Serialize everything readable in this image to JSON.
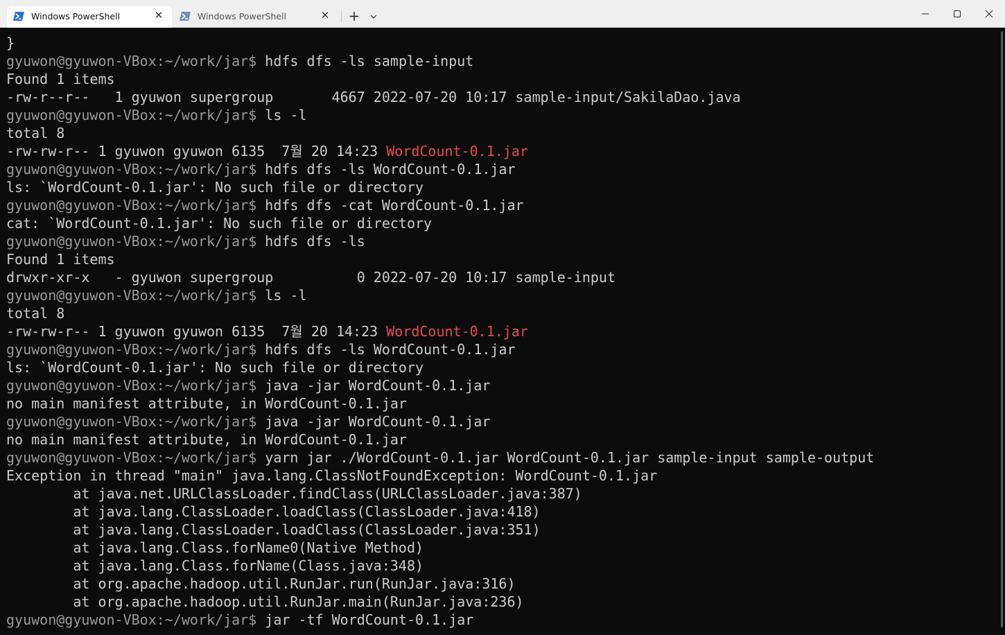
{
  "titlebar": {
    "tabs": [
      {
        "label": "Windows PowerShell",
        "active": true,
        "icon": "powershell-icon"
      },
      {
        "label": "Windows PowerShell",
        "active": false,
        "icon": "powershell-icon"
      }
    ],
    "close_glyph": "✕",
    "new_tab_glyph": "+",
    "dropdown_glyph": "⌄",
    "window_controls": {
      "minimize": "—",
      "maximize": "☐",
      "close": "✕"
    }
  },
  "colors": {
    "background": "#0c0c0c",
    "text": "#cccccc",
    "prompt": "#9a9a9a",
    "jar_highlight": "#e74856"
  },
  "terminal": {
    "lines": [
      {
        "kind": "output",
        "text": "}"
      },
      {
        "kind": "prompt",
        "user": "gyuwon@gyuwon-VBox",
        "path": ":~/work/jar$",
        "cmd": " hdfs dfs -ls sample-input"
      },
      {
        "kind": "output",
        "text": "Found 1 items"
      },
      {
        "kind": "output",
        "text": "-rw-r--r--   1 gyuwon supergroup       4667 2022-07-20 10:17 sample-input/SakilaDao.java"
      },
      {
        "kind": "prompt",
        "user": "gyuwon@gyuwon-VBox",
        "path": ":~/work/jar$",
        "cmd": " ls -l"
      },
      {
        "kind": "output",
        "text": "total 8"
      },
      {
        "kind": "highlight",
        "text": "-rw-rw-r-- 1 gyuwon gyuwon 6135  7월 20 14:23 ",
        "red": "WordCount-0.1.jar"
      },
      {
        "kind": "prompt",
        "user": "gyuwon@gyuwon-VBox",
        "path": ":~/work/jar$",
        "cmd": " hdfs dfs -ls WordCount-0.1.jar"
      },
      {
        "kind": "output",
        "text": "ls: `WordCount-0.1.jar': No such file or directory"
      },
      {
        "kind": "prompt",
        "user": "gyuwon@gyuwon-VBox",
        "path": ":~/work/jar$",
        "cmd": " hdfs dfs -cat WordCount-0.1.jar"
      },
      {
        "kind": "output",
        "text": "cat: `WordCount-0.1.jar': No such file or directory"
      },
      {
        "kind": "prompt",
        "user": "gyuwon@gyuwon-VBox",
        "path": ":~/work/jar$",
        "cmd": " hdfs dfs -ls"
      },
      {
        "kind": "output",
        "text": "Found 1 items"
      },
      {
        "kind": "output",
        "text": "drwxr-xr-x   - gyuwon supergroup          0 2022-07-20 10:17 sample-input"
      },
      {
        "kind": "prompt",
        "user": "gyuwon@gyuwon-VBox",
        "path": ":~/work/jar$",
        "cmd": " ls -l"
      },
      {
        "kind": "output",
        "text": "total 8"
      },
      {
        "kind": "highlight",
        "text": "-rw-rw-r-- 1 gyuwon gyuwon 6135  7월 20 14:23 ",
        "red": "WordCount-0.1.jar"
      },
      {
        "kind": "prompt",
        "user": "gyuwon@gyuwon-VBox",
        "path": ":~/work/jar$",
        "cmd": " hdfs dfs -ls WordCount-0.1.jar"
      },
      {
        "kind": "output",
        "text": "ls: `WordCount-0.1.jar': No such file or directory"
      },
      {
        "kind": "prompt",
        "user": "gyuwon@gyuwon-VBox",
        "path": ":~/work/jar$",
        "cmd": " java -jar WordCount-0.1.jar"
      },
      {
        "kind": "output",
        "text": "no main manifest attribute, in WordCount-0.1.jar"
      },
      {
        "kind": "prompt",
        "user": "gyuwon@gyuwon-VBox",
        "path": ":~/work/jar$",
        "cmd": " java -jar WordCount-0.1.jar"
      },
      {
        "kind": "output",
        "text": "no main manifest attribute, in WordCount-0.1.jar"
      },
      {
        "kind": "prompt",
        "user": "gyuwon@gyuwon-VBox",
        "path": ":~/work/jar$",
        "cmd": " yarn jar ./WordCount-0.1.jar WordCount-0.1.jar sample-input sample-output"
      },
      {
        "kind": "output",
        "text": "Exception in thread \"main\" java.lang.ClassNotFoundException: WordCount-0.1.jar"
      },
      {
        "kind": "output",
        "text": "        at java.net.URLClassLoader.findClass(URLClassLoader.java:387)"
      },
      {
        "kind": "output",
        "text": "        at java.lang.ClassLoader.loadClass(ClassLoader.java:418)"
      },
      {
        "kind": "output",
        "text": "        at java.lang.ClassLoader.loadClass(ClassLoader.java:351)"
      },
      {
        "kind": "output",
        "text": "        at java.lang.Class.forName0(Native Method)"
      },
      {
        "kind": "output",
        "text": "        at java.lang.Class.forName(Class.java:348)"
      },
      {
        "kind": "output",
        "text": "        at org.apache.hadoop.util.RunJar.run(RunJar.java:316)"
      },
      {
        "kind": "output",
        "text": "        at org.apache.hadoop.util.RunJar.main(RunJar.java:236)"
      },
      {
        "kind": "prompt",
        "user": "gyuwon@gyuwon-VBox",
        "path": ":~/work/jar$",
        "cmd": " jar -tf WordCount-0.1.jar"
      }
    ]
  }
}
